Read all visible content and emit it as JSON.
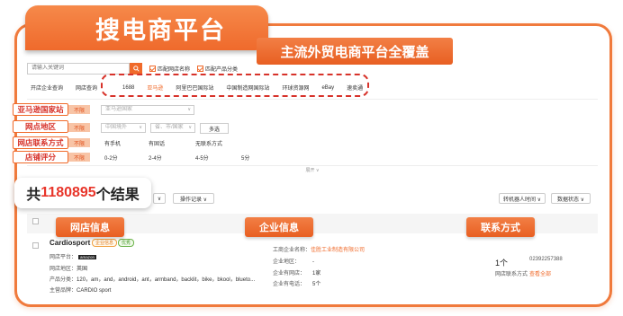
{
  "title": "搜电商平台",
  "callouts": {
    "main": "主流外贸电商平台全覆盖",
    "shop_info": "网店信息",
    "company_info": "企业信息",
    "contact": "联系方式"
  },
  "search": {
    "placeholder": "请输入关键词",
    "search_icon": "search-icon",
    "options": [
      "匹配网店名称",
      "匹配产品分类"
    ]
  },
  "nav_tabs": [
    "开店企业查询",
    "网店查询",
    "1688",
    "亚马逊",
    "阿里巴巴国际站",
    "中国制造网国际站",
    "环球资源网",
    "eBay",
    "速卖通"
  ],
  "active_tab": "亚马逊",
  "filters": {
    "labels": [
      "亚马逊国家站",
      "网点地区",
      "网店联系方式",
      "店铺评分"
    ],
    "unlimited": "不限",
    "country_select": "亚马逊国家",
    "region_select_1": "中国境外",
    "region_select_2": "省、市/国家",
    "multi_select": "多选",
    "contact_options": [
      "有手机",
      "有固话",
      "无联系方式"
    ],
    "rating_options": [
      "0-2分",
      "2-4分",
      "4-5分",
      "5分"
    ],
    "collapse": "展开 ∨"
  },
  "results": {
    "prefix": "共 ",
    "count": "1180895",
    "suffix": "个结果"
  },
  "toolbar": {
    "export_records": "操作记录 ∨",
    "sort": "转机器人时间 ∨",
    "data_status": "数据状态 ∨"
  },
  "shop": {
    "name": "Cardiosport",
    "badge_1": "企业信息",
    "badge_2": "优秀",
    "platform_label": "网店平台：",
    "platform_logo": "amazon",
    "region_label": "网店地区：",
    "region_value": "英国",
    "category_label": "产品分类：",
    "category_value": "120，am，and，android，ant，armband，backlit，bike，bkool，blueto...",
    "brand_label": "主营品牌：",
    "brand_value": "CARDIO sport"
  },
  "company": {
    "name_label": "工商企业名称：",
    "name_value": "佳胜工业制造有限公司",
    "region_label": "企业地区：",
    "region_value": "-",
    "shops_label": "企业有网店：",
    "shops_value": "1家",
    "phones_label": "企业有电话：",
    "phones_value": "5个"
  },
  "contact": {
    "count": "1个",
    "phone": "02392257388",
    "label": "网店联系方式",
    "view_all": "查看全部"
  },
  "colors": {
    "brand_orange": "#f06a2a",
    "accent_red": "#e8352a"
  }
}
